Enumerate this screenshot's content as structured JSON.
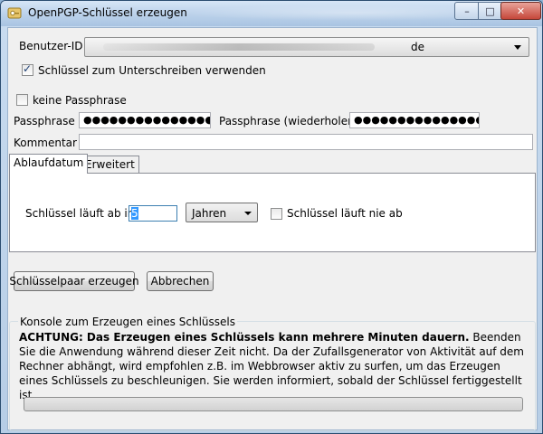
{
  "window": {
    "title": "OpenPGP-Schlüssel erzeugen",
    "controls": {
      "minimize": "–",
      "maximize": "□",
      "close": "✕"
    }
  },
  "form": {
    "user_id_label": "Benutzer-ID",
    "user_id_value": "de",
    "use_for_signing_label": "Schlüssel zum Unterschreiben verwenden",
    "use_for_signing_checked": true,
    "no_passphrase_label": "keine Passphrase",
    "no_passphrase_checked": false,
    "passphrase_label": "Passphrase",
    "passphrase_value": "●●●●●●●●●●●●●●●",
    "passphrase_repeat_label": "Passphrase (wiederholen)",
    "passphrase_repeat_value": "●●●●●●●●●●●●●●●",
    "comment_label": "Kommentar",
    "comment_value": ""
  },
  "tabs": [
    {
      "label": "Ablaufdatum",
      "active": true
    },
    {
      "label": "Erweitert",
      "active": false
    }
  ],
  "expiry": {
    "expires_in_label": "Schlüssel läuft ab in",
    "amount": "5",
    "unit": "Jahren",
    "never_expires_label": "Schlüssel läuft nie ab",
    "never_expires_checked": false
  },
  "buttons": {
    "generate": "Schlüsselpaar erzeugen",
    "cancel": "Abbrechen"
  },
  "console": {
    "title": "Konsole zum Erzeugen eines Schlüssels",
    "warning_bold": "ACHTUNG: Das Erzeugen eines Schlüssels kann mehrere Minuten dauern.",
    "warning_text": " Beenden Sie die Anwendung während dieser Zeit nicht. Da der Zufallsgenerator von Aktivität auf dem Rechner abhängt, wird empfohlen z.B. im Webbrowser aktiv zu surfen, um das Erzeugen eines Schlüssels zu beschleunigen. Sie werden informiert, sobald der Schlüssel fertiggestellt ist.",
    "progress": 0
  }
}
